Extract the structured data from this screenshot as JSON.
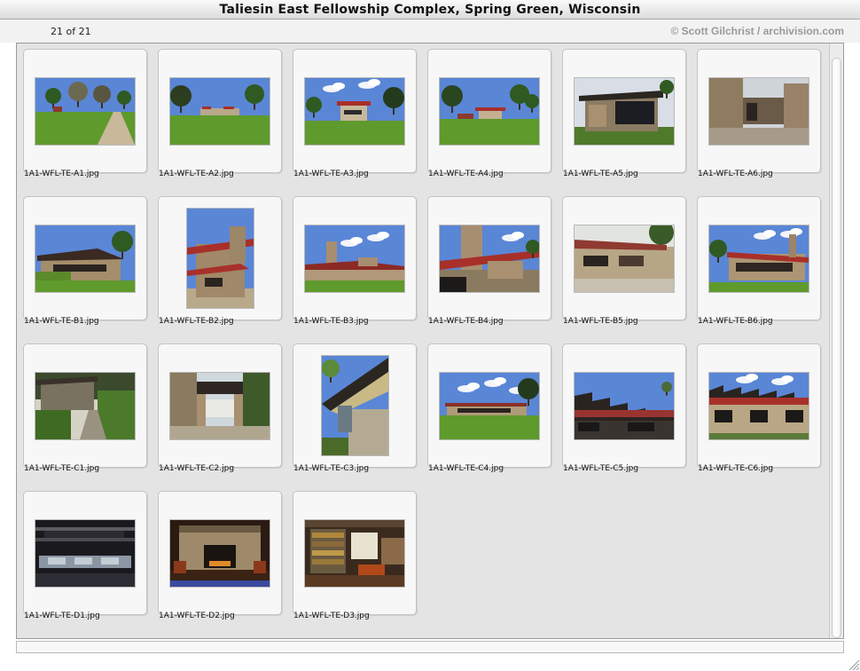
{
  "window": {
    "title": "Taliesin East Fellowship Complex, Spring Green, Wisconsin"
  },
  "status": {
    "count": "21 of 21",
    "credit": "© Scott Gilchrist / archivision.com"
  },
  "gallery": {
    "items": [
      {
        "file": "1A1-WFL-TE-A1.jpg",
        "orientation": "landscape",
        "scene": "lawn-path"
      },
      {
        "file": "1A1-WFL-TE-A2.jpg",
        "orientation": "landscape",
        "scene": "lawn-trees"
      },
      {
        "file": "1A1-WFL-TE-A3.jpg",
        "orientation": "landscape",
        "scene": "house-distant"
      },
      {
        "file": "1A1-WFL-TE-A4.jpg",
        "orientation": "landscape",
        "scene": "house-distant-2"
      },
      {
        "file": "1A1-WFL-TE-A5.jpg",
        "orientation": "landscape",
        "scene": "building-dark"
      },
      {
        "file": "1A1-WFL-TE-A6.jpg",
        "orientation": "landscape",
        "scene": "stone-court"
      },
      {
        "file": "1A1-WFL-TE-B1.jpg",
        "orientation": "landscape",
        "scene": "house-garden"
      },
      {
        "file": "1A1-WFL-TE-B2.jpg",
        "orientation": "portrait",
        "scene": "tower-portrait"
      },
      {
        "file": "1A1-WFL-TE-B3.jpg",
        "orientation": "landscape",
        "scene": "chimney-sky"
      },
      {
        "file": "1A1-WFL-TE-B4.jpg",
        "orientation": "landscape",
        "scene": "chimney-close"
      },
      {
        "file": "1A1-WFL-TE-B5.jpg",
        "orientation": "landscape",
        "scene": "long-wall"
      },
      {
        "file": "1A1-WFL-TE-B6.jpg",
        "orientation": "landscape",
        "scene": "red-roof"
      },
      {
        "file": "1A1-WFL-TE-C1.jpg",
        "orientation": "landscape",
        "scene": "steps-garden"
      },
      {
        "file": "1A1-WFL-TE-C2.jpg",
        "orientation": "landscape",
        "scene": "breezeway"
      },
      {
        "file": "1A1-WFL-TE-C3.jpg",
        "orientation": "portrait",
        "scene": "eave-portrait"
      },
      {
        "file": "1A1-WFL-TE-C4.jpg",
        "orientation": "landscape",
        "scene": "low-building"
      },
      {
        "file": "1A1-WFL-TE-C5.jpg",
        "orientation": "landscape",
        "scene": "sawtooth"
      },
      {
        "file": "1A1-WFL-TE-C6.jpg",
        "orientation": "landscape",
        "scene": "sawtooth-2"
      },
      {
        "file": "1A1-WFL-TE-D1.jpg",
        "orientation": "landscape",
        "scene": "studio-interior"
      },
      {
        "file": "1A1-WFL-TE-D2.jpg",
        "orientation": "landscape",
        "scene": "fireplace"
      },
      {
        "file": "1A1-WFL-TE-D3.jpg",
        "orientation": "landscape",
        "scene": "library"
      }
    ]
  },
  "colors": {
    "sky": "#5a86d6",
    "grass": "#5f9a2c",
    "roof": "#a8302a",
    "stone": "#b59a78",
    "dark": "#2a2520"
  }
}
